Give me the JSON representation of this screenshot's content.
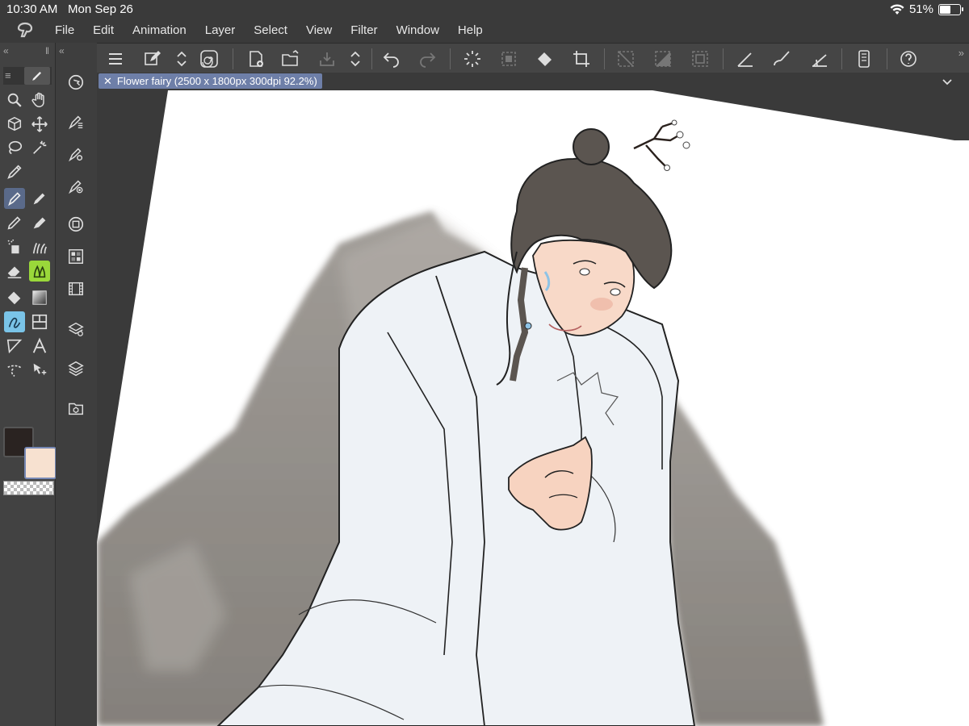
{
  "status": {
    "time": "10:30 AM",
    "date": "Mon Sep 26",
    "battery": "51%",
    "battery_level": 0.51
  },
  "menu": [
    "File",
    "Edit",
    "Animation",
    "Layer",
    "Select",
    "View",
    "Filter",
    "Window",
    "Help"
  ],
  "document_tab": {
    "title": "Flower fairy (2500 x 1800px 300dpi 92.2%)"
  },
  "colors": {
    "main": "#2a2321",
    "sub": "#f7e1d0",
    "accent": "#6e7fa8"
  },
  "command_icons": [
    "menu-icon",
    "edit-icon",
    "updown-icon",
    "spiral-icon",
    "new-file-icon",
    "open-folder-icon",
    "save-icon",
    "updown-icon",
    "undo-icon",
    "redo-icon",
    "loading-icon",
    "clear-selection-icon",
    "fill-icon",
    "crop-icon",
    "deselect-icon",
    "invert-icon",
    "select-icon",
    "ruler-icon",
    "brush-icon",
    "perspective-icon",
    "phone-icon",
    "help-icon"
  ],
  "tools": [
    "zoom",
    "hand",
    "3d",
    "move",
    "lasso",
    "magic-wand",
    "eyedropper",
    "pen",
    "marker",
    "pencil",
    "brush",
    "airbrush",
    "decoration",
    "eraser",
    "blend",
    "fill",
    "gradient",
    "contour",
    "frame",
    "ruler",
    "text",
    "balloon",
    "operation"
  ]
}
